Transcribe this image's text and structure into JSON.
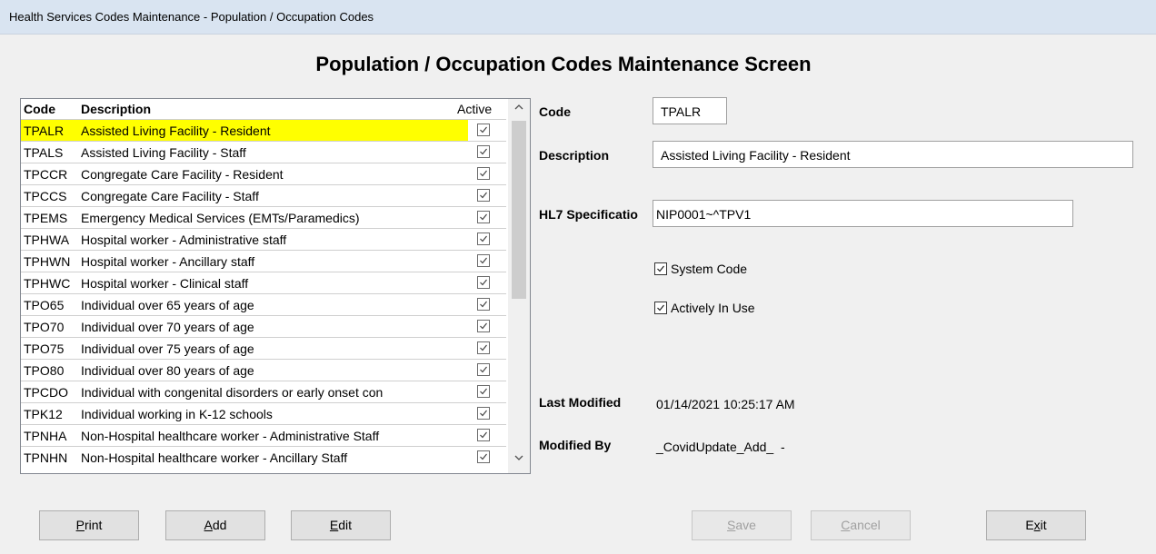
{
  "window": {
    "title": "Health Services Codes Maintenance - Population / Occupation Codes"
  },
  "screen_title": "Population / Occupation Codes Maintenance Screen",
  "list": {
    "headers": {
      "code": "Code",
      "description": "Description",
      "active": "Active"
    },
    "selected_index": 0,
    "rows": [
      {
        "code": "TPALR",
        "description": "Assisted Living Facility - Resident",
        "active": true
      },
      {
        "code": "TPALS",
        "description": "Assisted Living Facility - Staff",
        "active": true
      },
      {
        "code": "TPCCR",
        "description": "Congregate Care Facility - Resident",
        "active": true
      },
      {
        "code": "TPCCS",
        "description": "Congregate Care Facility - Staff",
        "active": true
      },
      {
        "code": "TPEMS",
        "description": "Emergency Medical Services (EMTs/Paramedics)",
        "active": true
      },
      {
        "code": "TPHWA",
        "description": "Hospital worker - Administrative staff",
        "active": true
      },
      {
        "code": "TPHWN",
        "description": "Hospital worker - Ancillary staff",
        "active": true
      },
      {
        "code": "TPHWC",
        "description": "Hospital worker - Clinical staff",
        "active": true
      },
      {
        "code": "TPO65",
        "description": "Individual over 65 years of age",
        "active": true
      },
      {
        "code": "TPO70",
        "description": "Individual over 70 years of age",
        "active": true
      },
      {
        "code": "TPO75",
        "description": "Individual over 75 years of age",
        "active": true
      },
      {
        "code": "TPO80",
        "description": "Individual over 80 years of age",
        "active": true
      },
      {
        "code": "TPCDO",
        "description": "Individual with congenital disorders or early onset con",
        "active": true
      },
      {
        "code": "TPK12",
        "description": "Individual working in K-12 schools",
        "active": true
      },
      {
        "code": "TPNHA",
        "description": "Non-Hospital healthcare worker - Administrative Staff",
        "active": true
      },
      {
        "code": "TPNHN",
        "description": "Non-Hospital healthcare worker - Ancillary Staff",
        "active": true
      }
    ]
  },
  "detail": {
    "code_label": "Code",
    "code_value": "TPALR",
    "description_label": "Description",
    "description_value": "Assisted Living Facility - Resident",
    "hl7_label": "HL7 Specificatio",
    "hl7_value": "NIP0001~^TPV1",
    "system_code_label": "System Code",
    "system_code_checked": true,
    "actively_in_use_label": "Actively In Use",
    "actively_in_use_checked": true,
    "last_modified_label": "Last Modified",
    "last_modified_value": "01/14/2021 10:25:17 AM",
    "modified_by_label": "Modified By",
    "modified_by_value": "_CovidUpdate_Add_  -"
  },
  "buttons": {
    "print": {
      "mnemonic": "P",
      "rest": "rint",
      "enabled": true
    },
    "add": {
      "mnemonic": "A",
      "rest": "dd",
      "enabled": true
    },
    "edit": {
      "mnemonic": "E",
      "rest": "dit",
      "enabled": true
    },
    "save": {
      "mnemonic": "S",
      "rest": "ave",
      "enabled": false
    },
    "cancel": {
      "mnemonic": "C",
      "rest": "ancel",
      "enabled": false
    },
    "exit": {
      "pre": "E",
      "mnemonic": "x",
      "rest": "it",
      "enabled": true
    }
  },
  "icons": {
    "checkbox": "check-icon",
    "scroll_up": "chevron-up-icon",
    "scroll_down": "chevron-down-icon"
  },
  "colors": {
    "selection": "#ffff00",
    "titlebar": "#d9e4f1"
  }
}
